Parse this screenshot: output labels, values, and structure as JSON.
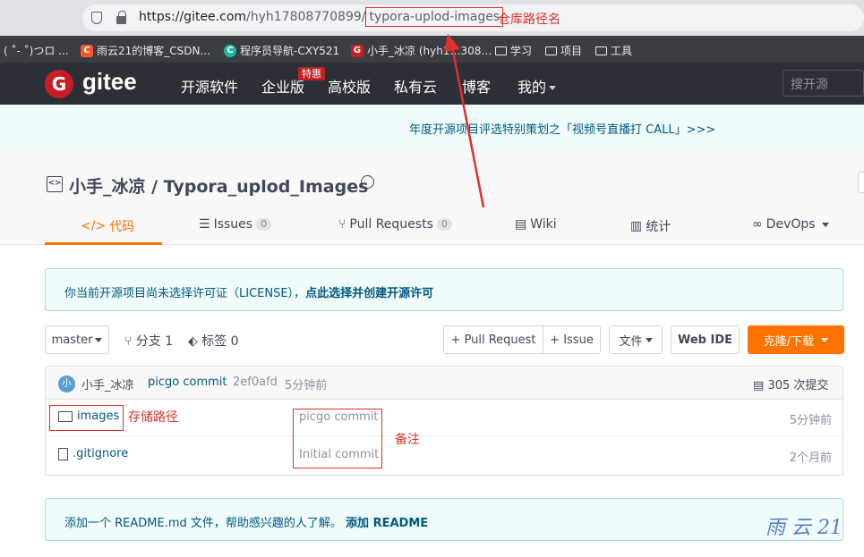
{
  "browser": {
    "url_host": "https://gitee.com",
    "url_path": "/hyh17808770899/",
    "url_repo": "typora-uplod-images",
    "bookmarks": [
      {
        "label": "( ˚- ˚)つロ ...",
        "icon": "",
        "color": ""
      },
      {
        "label": "雨云21的博客_CSDN...",
        "icon": "C",
        "color": "#fc5531"
      },
      {
        "label": "程序员导航-CXY521",
        "icon": "C",
        "color": "#21b8a6"
      },
      {
        "label": "小手_冰凉 (hyh1…308…",
        "icon": "G",
        "color": "#c71d23"
      },
      {
        "label": "学习",
        "icon": "folder-icon",
        "color": ""
      },
      {
        "label": "项目",
        "icon": "folder-icon",
        "color": ""
      },
      {
        "label": "工具",
        "icon": "folder-icon",
        "color": ""
      }
    ]
  },
  "annotations": {
    "repo_path": "仓库路径名",
    "storage_path": "存储路径",
    "remark": "备注"
  },
  "nav": {
    "logo": "gitee",
    "items": [
      "开源软件",
      "企业版",
      "高校版",
      "私有云",
      "博客",
      "我的"
    ],
    "badge": "特惠",
    "search_placeholder": "搜开源"
  },
  "banner": {
    "text": "年度开源项目评选特别策划之「视频号直播打 CALL」>>>"
  },
  "repo": {
    "owner": "小手_冰凉",
    "name": "Typora_uplod_Images",
    "title": "小手_冰凉 / Typora_uplod_Images",
    "tabs": [
      {
        "label": "代码",
        "icon": "code-icon",
        "count": ""
      },
      {
        "label": "Issues",
        "icon": "issues-icon",
        "count": "0"
      },
      {
        "label": "Pull Requests",
        "icon": "pull-request-icon",
        "count": "0"
      },
      {
        "label": "Wiki",
        "icon": "wiki-icon",
        "count": ""
      },
      {
        "label": "统计",
        "icon": "chart-icon",
        "count": ""
      },
      {
        "label": "DevOps",
        "icon": "devops-icon",
        "count": ""
      }
    ]
  },
  "license": {
    "text": "你当前开源项目尚未选择许可证（LICENSE），",
    "link": "点此选择并创建开源许可"
  },
  "toolbar": {
    "branch": "master",
    "branches": "分支 1",
    "tags": "标签 0",
    "pull_request": "+ Pull Request",
    "issue": "+ Issue",
    "files": "文件",
    "web_ide": "Web IDE",
    "clone": "克隆/下载"
  },
  "commit": {
    "avatar_letter": "小",
    "author": "小手_冰凉",
    "message": "picgo commit",
    "hash": "2ef0afd",
    "time": "5分钟前",
    "total": "305 次提交"
  },
  "files": [
    {
      "name": "images",
      "type": "folder",
      "message": "picgo commit",
      "time": "5分钟前"
    },
    {
      "name": ".gitignore",
      "type": "file",
      "message": "Initial commit",
      "time": "2个月前"
    }
  ],
  "readme": {
    "text": "添加一个 README.md 文件，帮助感兴趣的人了解。",
    "link": "添加 README"
  },
  "watermark": "雨 云 21"
}
